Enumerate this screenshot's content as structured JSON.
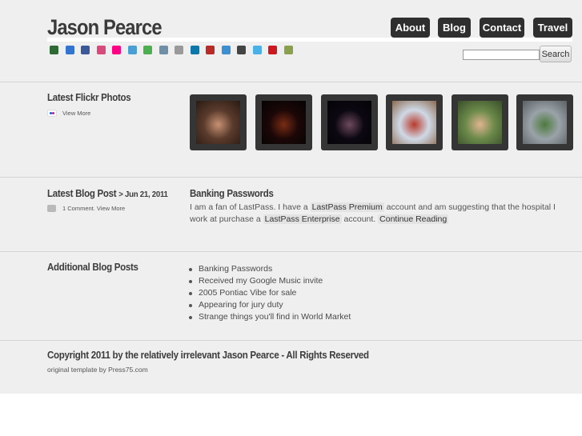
{
  "header": {
    "site_title": "Jason Pearce",
    "nav": [
      {
        "label": "About"
      },
      {
        "label": "Blog"
      },
      {
        "label": "Contact"
      },
      {
        "label": "Travel"
      }
    ]
  },
  "social_icons": [
    {
      "name": "friendfeed-icon",
      "color": "#2d6a36"
    },
    {
      "name": "delicious-icon",
      "color": "#3274d0"
    },
    {
      "name": "facebook-icon",
      "color": "#3b5998"
    },
    {
      "name": "flickr-grid-icon",
      "color": "#d84a7b"
    },
    {
      "name": "flickr-icon",
      "color": "#ff0084"
    },
    {
      "name": "foursquare-icon",
      "color": "#4aa0d5"
    },
    {
      "name": "google-icon",
      "color": "#4caf50"
    },
    {
      "name": "goodreads-icon",
      "color": "#6f8ea8"
    },
    {
      "name": "groceries-icon",
      "color": "#9a9a9a"
    },
    {
      "name": "linkedin-icon",
      "color": "#0e76a8"
    },
    {
      "name": "quora-icon",
      "color": "#b92b27"
    },
    {
      "name": "reader-icon",
      "color": "#3c8fd0"
    },
    {
      "name": "stack-icon",
      "color": "#444444"
    },
    {
      "name": "twitter-icon",
      "color": "#4bb0e6"
    },
    {
      "name": "youtube-icon",
      "color": "#cc181e"
    },
    {
      "name": "xing-icon",
      "color": "#8aa04a"
    }
  ],
  "search": {
    "value": "",
    "placeholder": "",
    "button_label": "Search"
  },
  "flickr": {
    "heading": "Latest Flickr Photos",
    "view_more": "View More",
    "photos": [
      {
        "name": "photo-people-icon",
        "colors": [
          "#5a3b2c",
          "#c79173",
          "#2a1a12"
        ]
      },
      {
        "name": "photo-fireworks-1-icon",
        "colors": [
          "#1c0707",
          "#7a2c14",
          "#050303"
        ]
      },
      {
        "name": "photo-fireworks-2-icon",
        "colors": [
          "#0c0812",
          "#6d4a5e",
          "#040306"
        ]
      },
      {
        "name": "photo-ballpark-selfie-icon",
        "colors": [
          "#cfd9e6",
          "#b83a2c",
          "#8b6a50"
        ]
      },
      {
        "name": "photo-child-selfie-icon",
        "colors": [
          "#6b8a4a",
          "#e0b48f",
          "#3a4d2a"
        ]
      },
      {
        "name": "photo-baseball-field-icon",
        "colors": [
          "#9aa3a9",
          "#4d7a3c",
          "#5a5f62"
        ]
      }
    ]
  },
  "latest_post": {
    "heading": "Latest Blog Post",
    "date": "> Jun 21, 2011",
    "meta": "1 Comment. View More",
    "title": "Banking Passwords",
    "body_1": "I am a fan of LastPass. I have a",
    "link_1": "LastPass Premium",
    "body_2": "account and am suggesting that the hospital I work at purchase a",
    "link_2": "LastPass Enterprise",
    "body_3": "account.",
    "continue": "Continue Reading"
  },
  "additional": {
    "heading": "Additional Blog Posts",
    "posts": [
      "Banking Passwords",
      "Received my Google Music invite",
      "2005 Pontiac Vibe for sale",
      "Appearing for jury duty",
      "Strange things you'll find in World Market"
    ]
  },
  "footer": {
    "copyright": "Copyright 2011 by the relatively irrelevant Jason Pearce - All Rights Reserved",
    "credit": "original template by Press75.com"
  }
}
